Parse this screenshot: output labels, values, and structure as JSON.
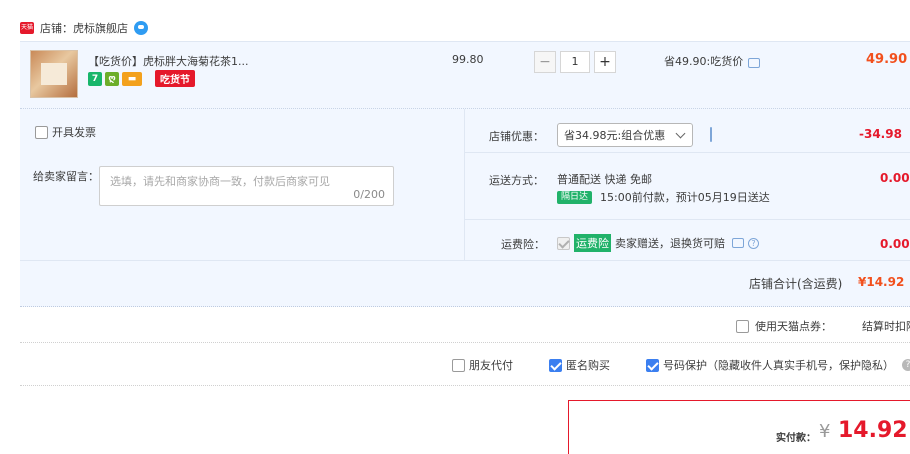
{
  "shop": {
    "label": "店铺：",
    "name": "虎标旗舰店",
    "badge": "天猫"
  },
  "item": {
    "title": "【吃货价】虎标胖大海菊花茶1...",
    "icons": [
      "7",
      "ღ",
      "▬"
    ],
    "festival_tag": "吃货节",
    "price": "99.80",
    "quantity": "1",
    "minus": "−",
    "plus": "+",
    "saving": "省49.90:吃货价",
    "total": "49.90"
  },
  "invoice": {
    "label": "开具发票"
  },
  "message": {
    "label": "给卖家留言：",
    "placeholder": "选填，请先和商家协商一致，付款后商家可见",
    "count": "0/200"
  },
  "discount": {
    "label": "店铺优惠：",
    "selected": "省34.98元:组合优惠",
    "value": "-34.98"
  },
  "shipping": {
    "label": "运送方式：",
    "method": "普通配送 快递 免邮",
    "next_day_tag": "隔日达",
    "eta": "15:00前付款，预计05月19日送达",
    "value": "0.00"
  },
  "insurance": {
    "label": "运费险：",
    "tag": "运费险",
    "desc": "卖家赠送，退换货可赔",
    "value": "0.00"
  },
  "shop_total": {
    "label": "店铺合计(含运费)",
    "value": "¥14.92"
  },
  "points": {
    "label": "使用天猫点券：",
    "settle": "结算时扣除"
  },
  "options": {
    "friend_pay": "朋友代付",
    "anonymous": "匿名购买",
    "number_protect": "号码保护（隐藏收件人真实手机号，保护隐私）"
  },
  "payment": {
    "label": "实付款：",
    "currency": "¥",
    "amount": "14.92"
  },
  "colors": {
    "accent_red": "#e5192b",
    "price_orange": "#f2501d",
    "panel_blue": "#f2f7ff",
    "check_blue": "#3b7ff0",
    "green_tag": "#21b26a"
  }
}
